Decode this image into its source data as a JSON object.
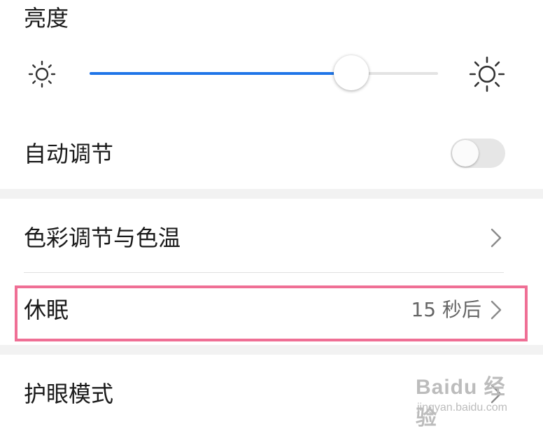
{
  "brightness": {
    "title": "亮度",
    "level_percent": 75,
    "min_icon": "sun-dim-icon",
    "max_icon": "sun-bright-icon",
    "accent_color": "#1f75e8"
  },
  "auto_adjust": {
    "label": "自动调节",
    "enabled": false
  },
  "color_temp": {
    "label": "色彩调节与色温",
    "icon": "chevron-right-icon"
  },
  "sleep": {
    "label": "休眠",
    "value": "15 秒后",
    "icon": "chevron-right-icon",
    "highlight_color": "#ef6f95"
  },
  "eye_comfort": {
    "label": "护眼模式",
    "icon": "chevron-right-icon"
  },
  "watermark": {
    "main": "Baidu 经验",
    "sub": "jingyan.baidu.com"
  }
}
